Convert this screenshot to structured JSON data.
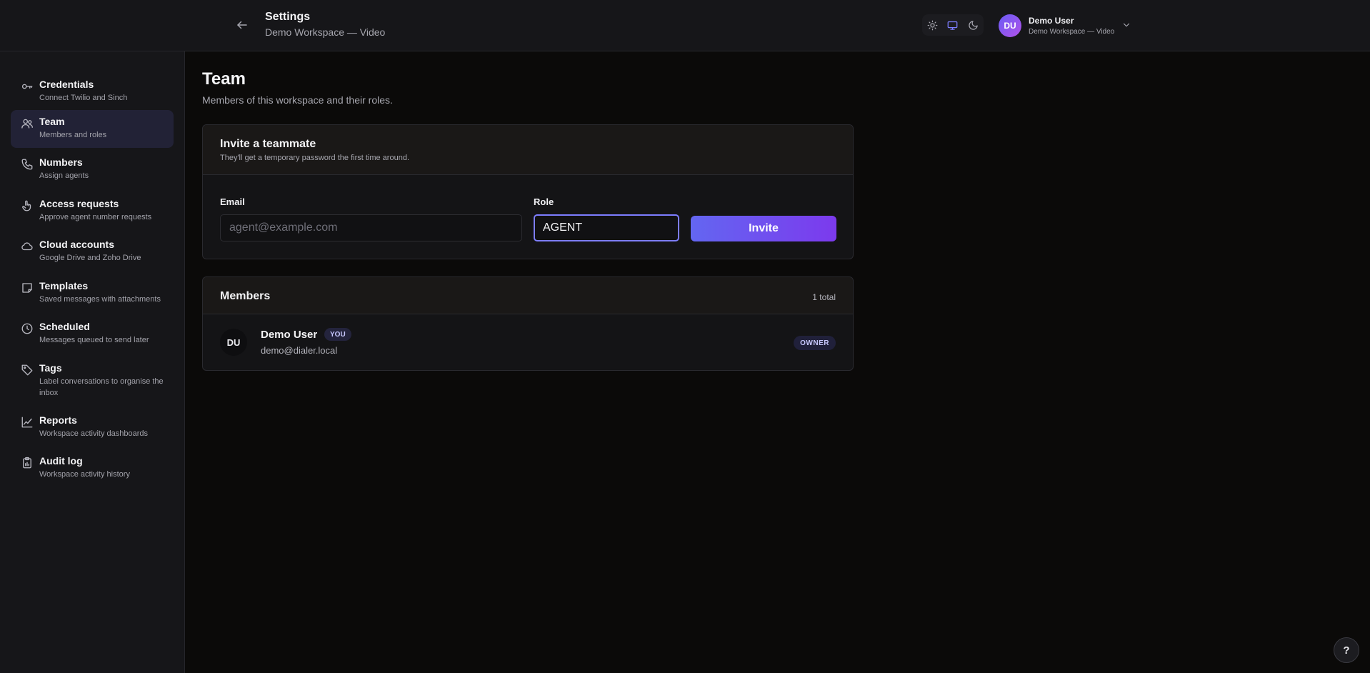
{
  "header": {
    "title": "Settings",
    "subtitle": "Demo Workspace — Video",
    "theme_options": [
      "light-icon",
      "system-icon",
      "dark-icon"
    ],
    "active_theme": "system",
    "user": {
      "initials": "DU",
      "name": "Demo User",
      "workspace": "Demo Workspace — Video"
    }
  },
  "sidebar": {
    "items": [
      {
        "label": "Credentials",
        "desc": "Connect Twilio and Sinch",
        "icon": "key-icon"
      },
      {
        "label": "Team",
        "desc": "Members and roles",
        "icon": "users-icon",
        "active": true
      },
      {
        "label": "Numbers",
        "desc": "Assign agents",
        "icon": "phone-icon"
      },
      {
        "label": "Access requests",
        "desc": "Approve agent number requests",
        "icon": "hand-pointer-icon"
      },
      {
        "label": "Cloud accounts",
        "desc": "Google Drive and Zoho Drive",
        "icon": "cloud-icon"
      },
      {
        "label": "Templates",
        "desc": "Saved messages with attachments",
        "icon": "sticky-note-icon"
      },
      {
        "label": "Scheduled",
        "desc": "Messages queued to send later",
        "icon": "clock-icon"
      },
      {
        "label": "Tags",
        "desc": "Label conversations to organise the inbox",
        "icon": "tag-icon"
      },
      {
        "label": "Reports",
        "desc": "Workspace activity dashboards",
        "icon": "chart-line-icon"
      },
      {
        "label": "Audit log",
        "desc": "Workspace activity history",
        "icon": "clipboard-icon"
      }
    ]
  },
  "main": {
    "title": "Team",
    "subtitle": "Members of this workspace and their roles.",
    "invite": {
      "title": "Invite a teammate",
      "desc": "They'll get a temporary password the first time around.",
      "email_label": "Email",
      "email_placeholder": "agent@example.com",
      "email_value": "",
      "role_label": "Role",
      "role_value": "AGENT",
      "button_label": "Invite"
    },
    "members": {
      "title": "Members",
      "count_label": "1 total",
      "rows": [
        {
          "initials": "DU",
          "name": "Demo User",
          "you_badge": "YOU",
          "email": "demo@dialer.local",
          "role": "OWNER"
        }
      ]
    }
  },
  "help_label": "?",
  "colors": {
    "accent": "#6366f1",
    "accent_end": "#7c3aed",
    "active_nav_bg": "#222236",
    "background": "#0b0a09",
    "panel": "#161619"
  }
}
